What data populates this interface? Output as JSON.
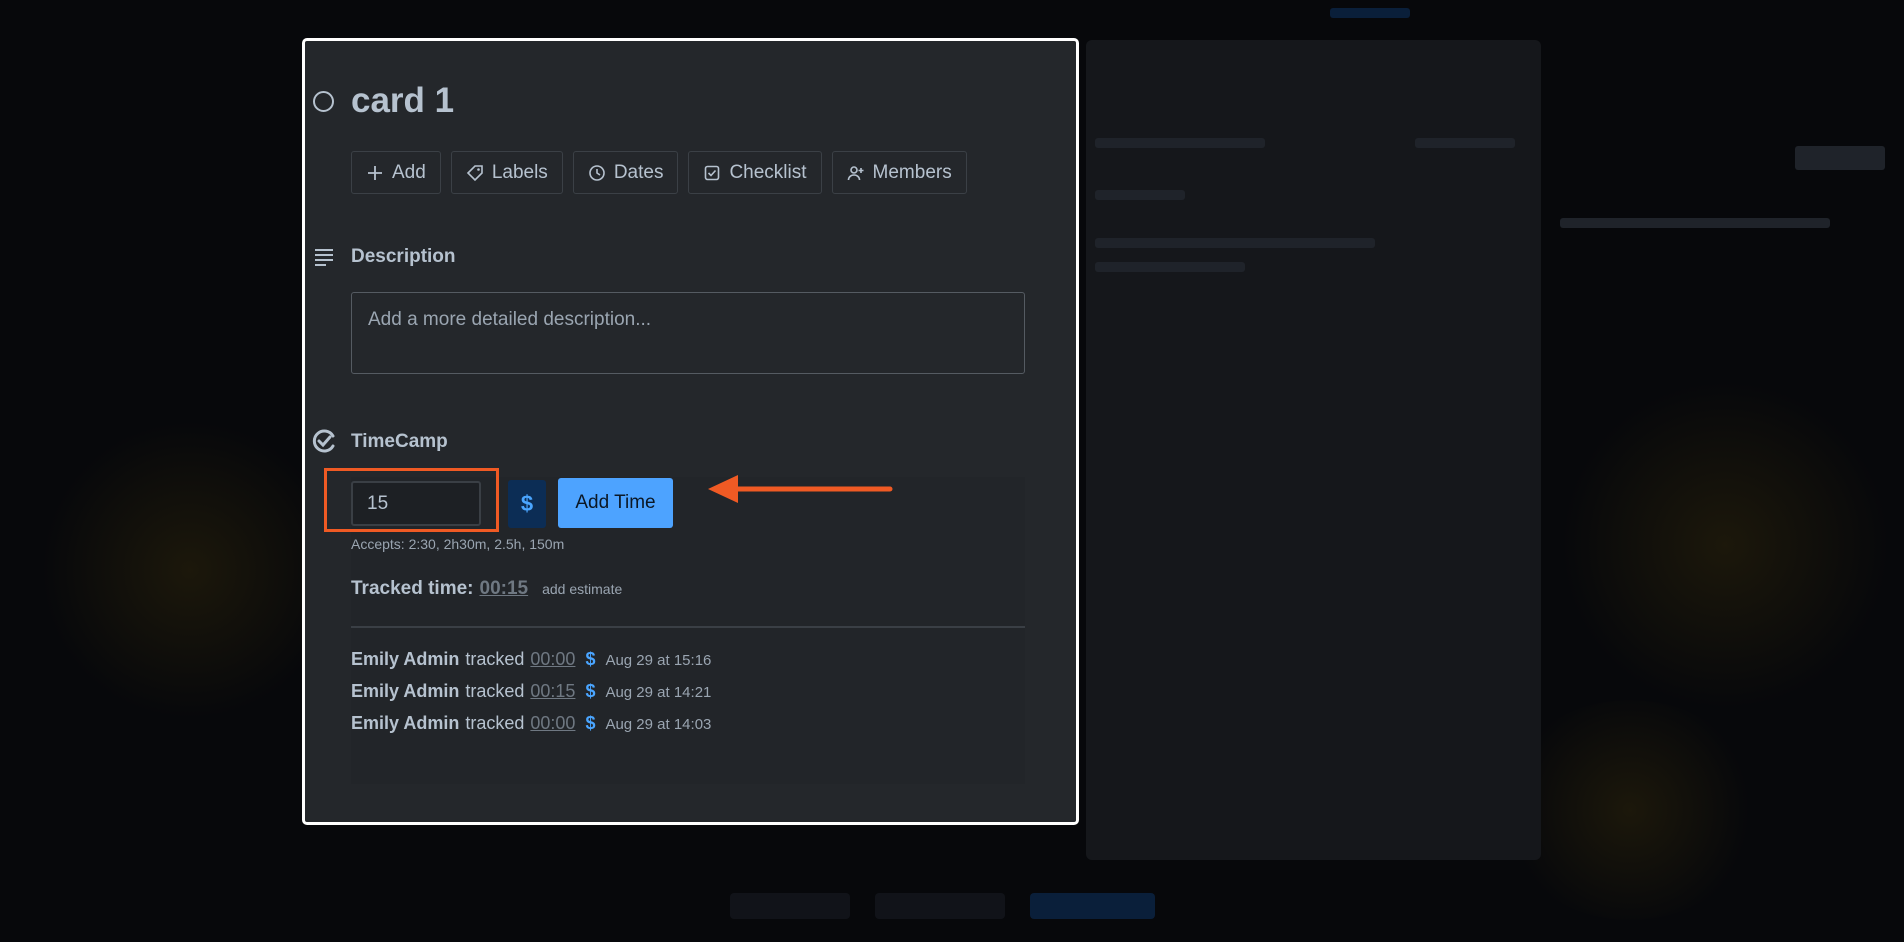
{
  "card": {
    "title": "card 1",
    "actions": [
      {
        "label": "Add",
        "icon": "plus-icon"
      },
      {
        "label": "Labels",
        "icon": "tag-icon"
      },
      {
        "label": "Dates",
        "icon": "clock-icon"
      },
      {
        "label": "Checklist",
        "icon": "checklist-icon"
      },
      {
        "label": "Members",
        "icon": "add-member-icon"
      }
    ],
    "description": {
      "title": "Description",
      "placeholder": "Add a more detailed description..."
    }
  },
  "timecamp": {
    "title": "TimeCamp",
    "input_value": "15",
    "billable_symbol": "$",
    "add_button": "Add Time",
    "accepts": "Accepts: 2:30, 2h30m, 2.5h, 150m",
    "tracked_label": "Tracked time:",
    "tracked_value": "00:15",
    "add_estimate": "add estimate",
    "entries": [
      {
        "user": "Emily Admin",
        "verb": "tracked",
        "duration": "00:00",
        "billable": "$",
        "when": "Aug 29 at 15:16"
      },
      {
        "user": "Emily Admin",
        "verb": "tracked",
        "duration": "00:15",
        "billable": "$",
        "when": "Aug 29 at 14:21"
      },
      {
        "user": "Emily Admin",
        "verb": "tracked",
        "duration": "00:00",
        "billable": "$",
        "when": "Aug 29 at 14:03"
      }
    ]
  },
  "colors": {
    "modal_bg": "#24272b",
    "highlight": "#f05a24",
    "accent": "#4da3ff",
    "arrow": "#f05a24"
  }
}
